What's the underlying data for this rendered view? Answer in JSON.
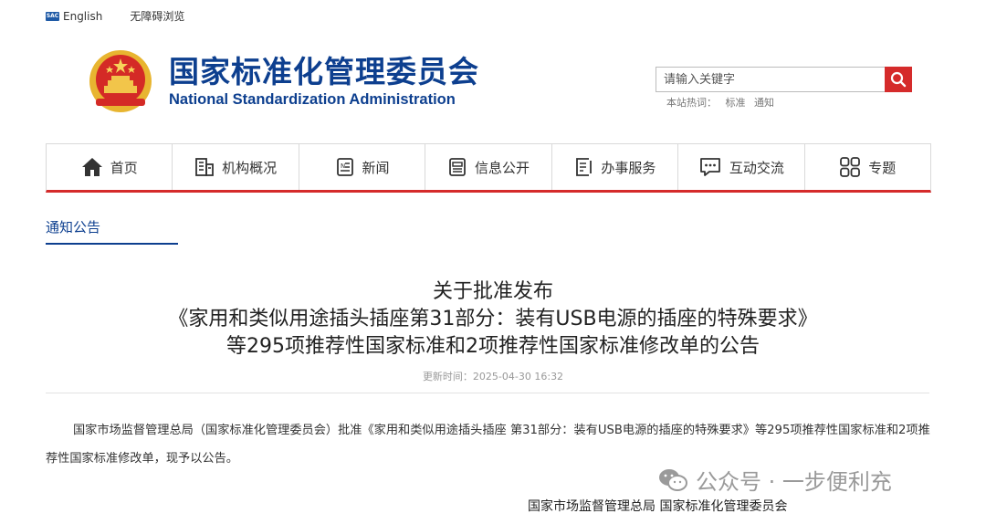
{
  "topbar": {
    "badge": "SAC",
    "english": "English",
    "accessibility": "无障碍浏览"
  },
  "header": {
    "title_cn": "国家标准化管理委员会",
    "title_en": "National Standardization Administration"
  },
  "search": {
    "placeholder": "请输入关键字",
    "hot_label": "本站热词：",
    "hot_words": [
      "标准",
      "通知"
    ]
  },
  "nav": {
    "items": [
      "首页",
      "机构概况",
      "新闻",
      "信息公开",
      "办事服务",
      "互动交流",
      "专题"
    ]
  },
  "section_tab": "通知公告",
  "article": {
    "title_lines": [
      "关于批准发布",
      "《家用和类似用途插头插座第31部分：装有USB电源的插座的特殊要求》",
      "等295项推荐性国家标准和2项推荐性国家标准修改单的公告"
    ],
    "updated": "更新时间：2025-04-30 16:32",
    "body": "国家市场监督管理总局（国家标准化管理委员会）批准《家用和类似用途插头插座 第31部分：装有USB电源的插座的特殊要求》等295项推荐性国家标准和2项推荐性国家标准修改单，现予以公告。",
    "signature": "国家市场监督管理总局 国家标准化管理委员会"
  },
  "watermark": "公众号 · 一步便利充",
  "colors": {
    "brand_blue": "#0d3f8f",
    "accent_red": "#d52b2b"
  }
}
